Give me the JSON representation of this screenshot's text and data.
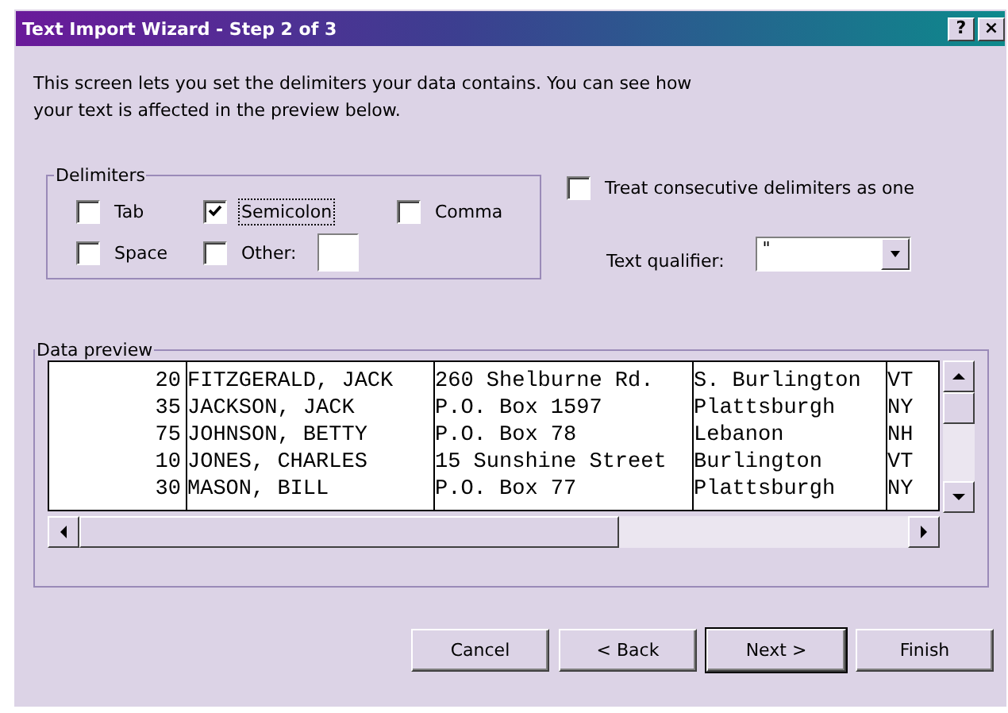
{
  "window": {
    "title": "Text Import Wizard - Step 2 of 3",
    "title_buttons": [
      "?",
      "×"
    ]
  },
  "intro": "This screen lets you set the delimiters your data contains.  You can see how your text is affected in the preview below.",
  "delimiters": {
    "label": "Delimiters",
    "options": [
      {
        "label": "Tab",
        "checked": false,
        "focused": false
      },
      {
        "label": "Semicolon",
        "checked": true,
        "focused": true
      },
      {
        "label": "Comma",
        "checked": false,
        "focused": false
      },
      {
        "label": "Space",
        "checked": false,
        "focused": false
      },
      {
        "label": "Other:",
        "checked": false,
        "focused": false
      }
    ]
  },
  "consecutive": {
    "label": "Treat consecutive delimiters as one",
    "checked": false
  },
  "qualifier": {
    "label": "Text qualifier:",
    "value": "\""
  },
  "preview": {
    "label": "Data preview",
    "rows": [
      [
        "20",
        "FITZGERALD, JACK",
        "260 Shelburne Rd.",
        "S. Burlington",
        "VT"
      ],
      [
        "35",
        "JACKSON, JACK",
        "P.O. Box 1597",
        "Plattsburgh",
        "NY"
      ],
      [
        "75",
        "JOHNSON, BETTY",
        "P.O. Box 78",
        "Lebanon",
        "NH"
      ],
      [
        "10",
        "JONES, CHARLES",
        "15 Sunshine Street",
        "Burlington",
        "VT"
      ],
      [
        "30",
        "MASON, BILL",
        "P.O. Box 77",
        "Plattsburgh",
        "NY"
      ]
    ]
  },
  "buttons": [
    {
      "label": "Cancel",
      "default": false
    },
    {
      "label": "< Back",
      "default": false
    },
    {
      "label": "Next >",
      "default": true
    },
    {
      "label": "Finish",
      "default": false
    }
  ]
}
